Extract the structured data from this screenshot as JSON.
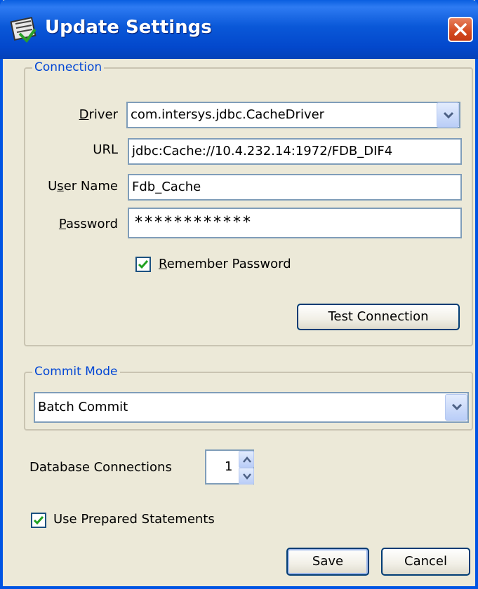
{
  "window": {
    "title": "Update Settings"
  },
  "connection": {
    "legend": "Connection",
    "driver": {
      "label_underlined": "D",
      "label_rest": "river",
      "value": "com.intersys.jdbc.CacheDriver"
    },
    "url": {
      "label": "URL",
      "value": "jdbc:Cache://10.4.232.14:1972/FDB_DIF4"
    },
    "username": {
      "label_pre": "U",
      "label_underlined": "s",
      "label_rest": "er Name",
      "value": "Fdb_Cache"
    },
    "password": {
      "label_underlined": "P",
      "label_rest": "assword",
      "value": "************"
    },
    "remember": {
      "label_underlined": "R",
      "label_rest": "emember Password",
      "checked": true
    },
    "test_button": "Test Connection"
  },
  "commit_mode": {
    "legend": "Commit Mode",
    "selected": "Batch Commit"
  },
  "database_connections": {
    "label": "Database Connections",
    "value": "1"
  },
  "prepared_statements": {
    "label": "Use Prepared Statements",
    "checked": true
  },
  "buttons": {
    "save": "Save",
    "cancel": "Cancel"
  },
  "colors": {
    "title_bar": "#0a58d8",
    "legend_text": "#0046d5",
    "close_button": "#d44a1f",
    "check": "#21a121"
  }
}
